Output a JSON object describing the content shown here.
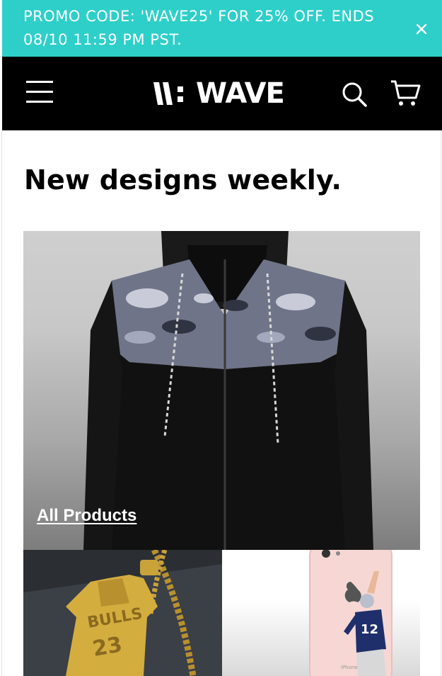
{
  "promo": {
    "text": "PROMO CODE: 'WAVE25' FOR 25% OFF. ENDS 08/10 11:59 PM PST.",
    "close_icon": "close-icon"
  },
  "header": {
    "menu_icon": "hamburger-menu-icon",
    "logo_text": "WAVE",
    "search_icon": "search-icon",
    "cart_icon": "cart-icon"
  },
  "main": {
    "title": "New designs weekly.",
    "collections": [
      {
        "label": "All Products",
        "image": "camo-hoodie"
      },
      {
        "image": "gold-jersey-pendant"
      },
      {
        "image": "football-player-phone-case"
      }
    ]
  },
  "colors": {
    "promo_bg": "#2ecfc9",
    "header_bg": "#000000",
    "text": "#000000"
  }
}
